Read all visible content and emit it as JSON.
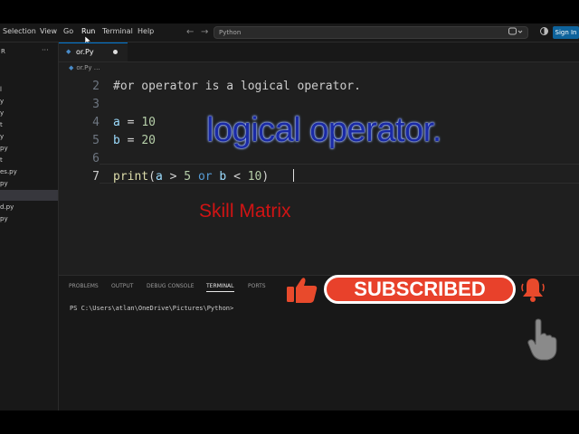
{
  "menu": [
    "Selection",
    "View",
    "Go",
    "Run",
    "Terminal",
    "Help"
  ],
  "search": {
    "text": "Python"
  },
  "signin": "Sign In",
  "sidebar": {
    "header": "R",
    "more": "···",
    "items": [
      "l",
      "y",
      "y",
      "t",
      "y",
      "py",
      "t",
      "es.py",
      "py",
      "",
      "d.py",
      "py"
    ],
    "selected_index": 9
  },
  "tab": {
    "name": "or.Py"
  },
  "breadcrumb": {
    "file": "or.Py",
    "more": "…"
  },
  "code": {
    "lines": [
      {
        "num": "2",
        "text": "#or operator is a logical operator."
      },
      {
        "num": "3",
        "text": ""
      },
      {
        "num": "4",
        "text": "a = 10"
      },
      {
        "num": "5",
        "text": "b = 20"
      },
      {
        "num": "6",
        "text": ""
      },
      {
        "num": "7",
        "text": "print(a > 5 or b < 10)"
      }
    ],
    "active_line": "7"
  },
  "overlay_title": "logical operator.",
  "watermark": "Skill Matrix",
  "panel": {
    "tabs": [
      "PROBLEMS",
      "OUTPUT",
      "DEBUG CONSOLE",
      "TERMINAL",
      "PORTS"
    ],
    "active_tab": "TERMINAL",
    "prompt": "PS C:\\Users\\atlan\\OneDrive\\Pictures\\Python>"
  },
  "subscribe": "SUBSCRIBED",
  "colors": {
    "accent": "#0078d4",
    "subscribe_bg": "#e8412b",
    "skill": "#d01414",
    "title": "#1a2aa6"
  }
}
